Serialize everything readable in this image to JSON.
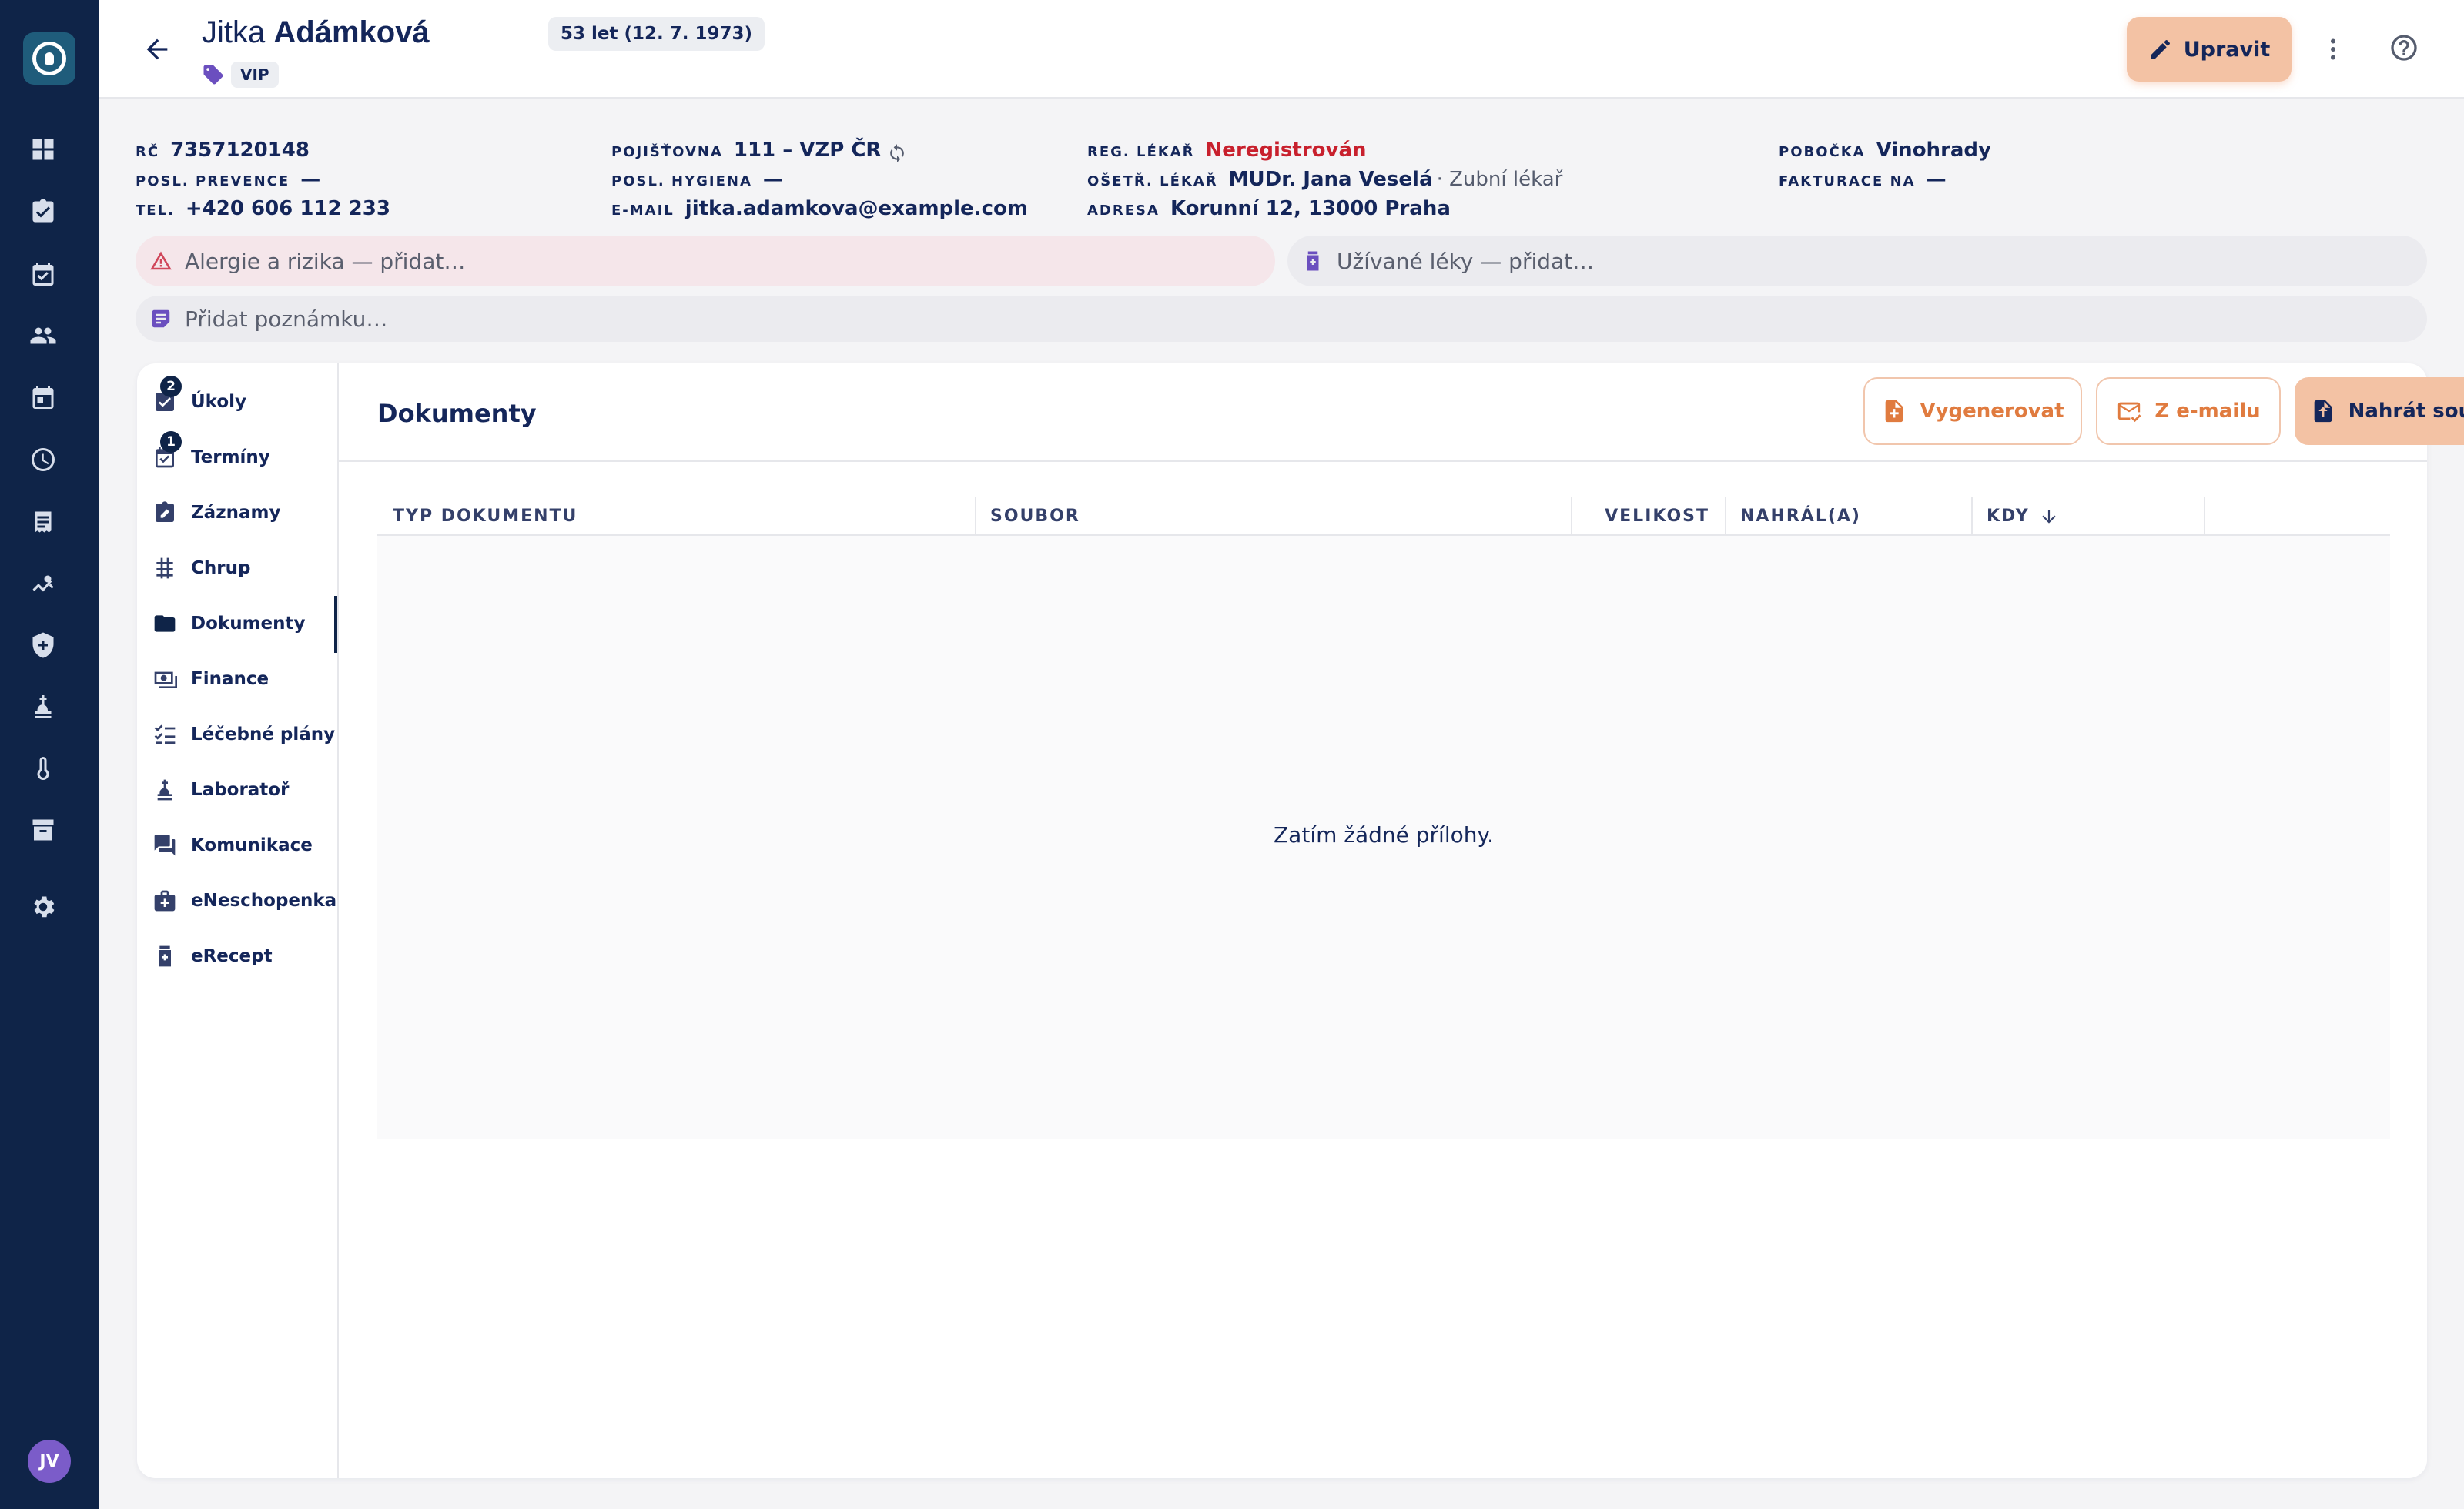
{
  "patient": {
    "first_name": "Jitka",
    "last_name": "Adámková",
    "age_label": "53 let (12. 7. 1973)",
    "tag": "VIP"
  },
  "header": {
    "edit_label": "Upravit"
  },
  "info": {
    "rc_label": "RČ",
    "rc_value": "7357120148",
    "prevence_label": "POSL. PREVENCE",
    "prevence_value": "—",
    "tel_label": "TEL.",
    "tel_value": "+420 606 112 233",
    "pojistovna_label": "POJIŠŤOVNA",
    "pojistovna_value": "111 – VZP ČR",
    "hygiena_label": "POSL. HYGIENA",
    "hygiena_value": "—",
    "email_label": "E-MAIL",
    "email_value": "jitka.adamkova@example.com",
    "reg_label": "REG. LÉKAŘ",
    "reg_value": "Neregistrován",
    "oset_label": "OŠETŘ. LÉKAŘ",
    "oset_value": "MUDr. Jana Veselá",
    "oset_role": "· Zubní lékař",
    "adresa_label": "ADRESA",
    "adresa_value": "Korunní 12, 13000 Praha",
    "pobocka_label": "POBOČKA",
    "pobocka_value": "Vinohrady",
    "fakturace_label": "FAKTURACE NA",
    "fakturace_value": "—"
  },
  "bars": {
    "allergy_placeholder": "Alergie a rizika — přidat…",
    "meds_placeholder": "Užívané léky — přidat…",
    "note_placeholder": "Přidat poznámku…"
  },
  "subnav": {
    "items": [
      {
        "label": "Úkoly",
        "badge": "2",
        "icon": "task-check-icon"
      },
      {
        "label": "Termíny",
        "badge": "1",
        "icon": "calendar-check-icon"
      },
      {
        "label": "Záznamy",
        "icon": "clipboard-edit-icon"
      },
      {
        "label": "Chrup",
        "icon": "grid-icon"
      },
      {
        "label": "Dokumenty",
        "icon": "folder-icon"
      },
      {
        "label": "Finance",
        "icon": "money-icon"
      },
      {
        "label": "Léčebné plány",
        "icon": "checklist-icon"
      },
      {
        "label": "Laboratoř",
        "icon": "microscope-icon"
      },
      {
        "label": "Komunikace",
        "icon": "chat-icon"
      },
      {
        "label": "eNeschopenka",
        "icon": "medical-bag-icon"
      },
      {
        "label": "eRecept",
        "icon": "prescription-icon"
      }
    ],
    "active": "Dokumenty"
  },
  "documents": {
    "title": "Dokumenty",
    "btn_generate": "Vygenerovat",
    "btn_email": "Z e-mailu",
    "btn_upload": "Nahrát soubor",
    "columns": [
      "TYP DOKUMENTU",
      "SOUBOR",
      "VELIKOST",
      "NAHRÁL(A)",
      "KDY"
    ],
    "sort_column": "KDY",
    "sort_direction": "descending",
    "empty_text": "Zatím žádné přílohy."
  },
  "user": {
    "initials": "JV"
  },
  "colors": {
    "sidebar": "#0f2448",
    "accent": "#f3c2a4",
    "accent_text": "#e07b3f",
    "alert": "#c8202d"
  }
}
